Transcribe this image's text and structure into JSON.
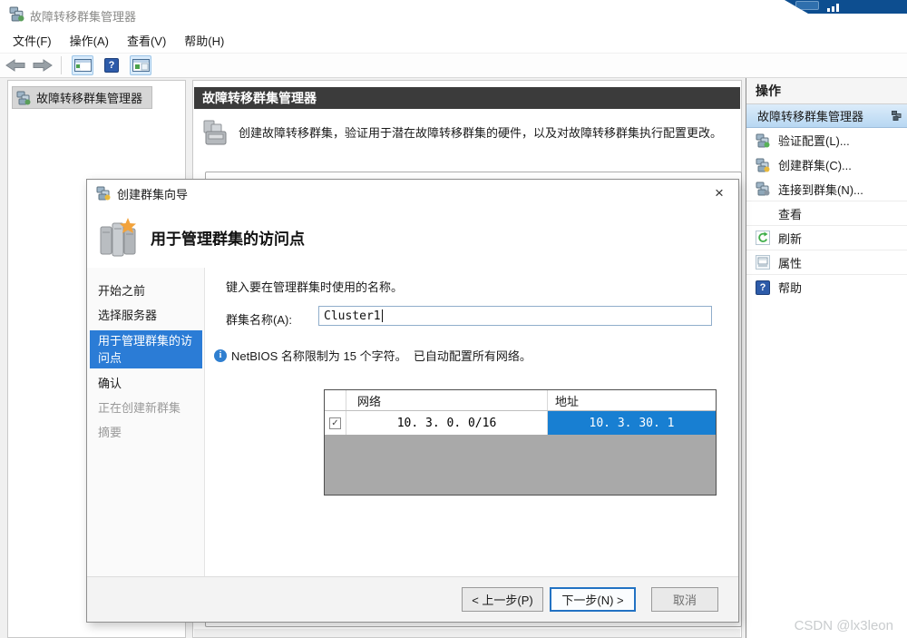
{
  "titlebar": {
    "title": "故障转移群集管理器"
  },
  "menu": {
    "items": [
      "文件(F)",
      "操作(A)",
      "查看(V)",
      "帮助(H)"
    ]
  },
  "toolbar": {
    "help_glyph": "?"
  },
  "tree": {
    "root_label": "故障转移群集管理器"
  },
  "main_panel": {
    "header": "故障转移群集管理器",
    "description": "创建故障转移群集，验证用于潜在故障转移群集的硬件，以及对故障转移群集执行配置更改。"
  },
  "actions_panel": {
    "title": "操作",
    "selected": "故障转移群集管理器",
    "items": [
      "验证配置(L)...",
      "创建群集(C)...",
      "连接到群集(N)...",
      "查看",
      "刷新",
      "属性",
      "帮助"
    ],
    "help_glyph": "?"
  },
  "wizard": {
    "window_title": "创建群集向导",
    "close_glyph": "×",
    "page_title": "用于管理群集的访问点",
    "steps": [
      "开始之前",
      "选择服务器",
      "用于管理群集的访问点",
      "确认",
      "正在创建新群集",
      "摘要"
    ],
    "active_step_index": 2,
    "prompt": "键入要在管理群集时使用的名称。",
    "name_label": "群集名称(A):",
    "name_value": "Cluster1",
    "info_glyph": "i",
    "info_text": "NetBIOS 名称限制为 15 个字符。  已自动配置所有网络。",
    "network_table": {
      "columns": [
        "网络",
        "地址"
      ],
      "check_glyph": "✓",
      "rows": [
        {
          "checked": true,
          "network": "10. 3. 0. 0/16",
          "address": "10. 3. 30. 1"
        }
      ]
    },
    "buttons": {
      "back": "< 上一步(P)",
      "next": "下一步(N) >",
      "cancel": "取消"
    }
  },
  "watermark": "CSDN @lx3leon",
  "colors": {
    "accent_blue": "#2b7cd6",
    "selection_blue": "#187fd2",
    "header_dark": "#3b3b3b",
    "actions_highlight": "#bcd8f2",
    "banner_blue": "#0d4e90"
  }
}
